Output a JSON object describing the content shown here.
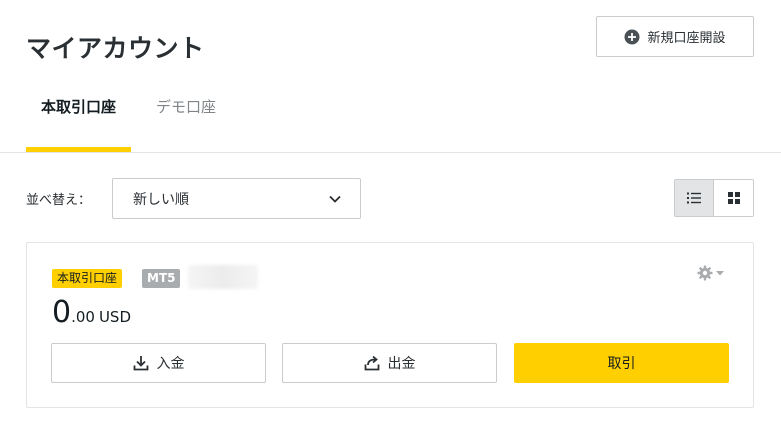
{
  "header": {
    "title": "マイアカウント",
    "new_account_label": "新規口座開設"
  },
  "tabs": [
    {
      "label": "本取引口座",
      "active": true
    },
    {
      "label": "デモ口座",
      "active": false
    }
  ],
  "sort": {
    "label": "並べ替え：",
    "selected": "新しい順"
  },
  "view_toggle": {
    "active": "list"
  },
  "account": {
    "type_badge": "本取引口座",
    "platform_badge": "MT5",
    "balance_int": "0",
    "balance_dec": ".00",
    "currency": "USD",
    "deposit_label": "入金",
    "withdraw_label": "出金",
    "trade_label": "取引"
  },
  "colors": {
    "accent": "#ffcf00",
    "badge_gray": "#a8acae",
    "border": "#c9cbcd"
  }
}
